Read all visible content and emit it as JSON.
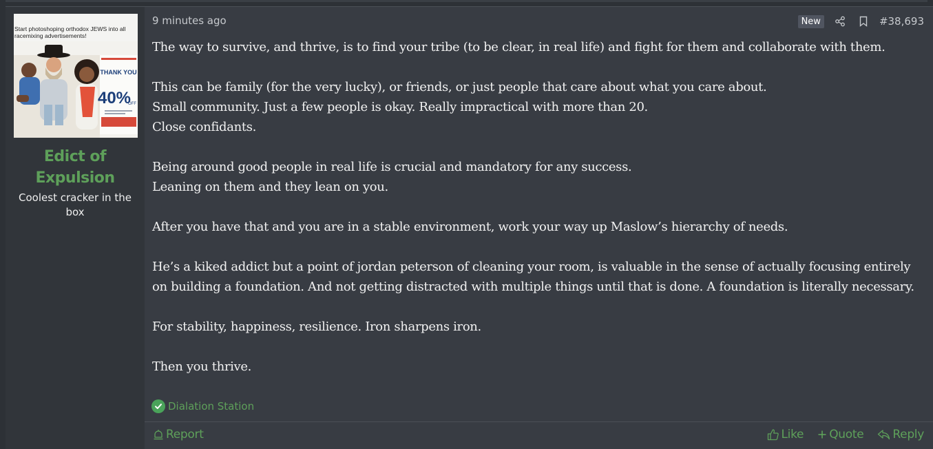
{
  "user": {
    "avatar_caption": "Start photoshoping orthodox JEWS into all racemixing advertisements!",
    "avatar_ad_line1": "THANK YOU",
    "avatar_ad_percent": "40%",
    "avatar_ad_off": "OFF",
    "name": "Edict of Expulsion",
    "title": "Coolest cracker in the box"
  },
  "meta": {
    "time": "9 minutes ago",
    "badge": "New",
    "post_number": "#38,693"
  },
  "body": {
    "paragraphs": [
      "The way to survive, and thrive, is to find your tribe (to be clear, in real life) and fight for them and collaborate with them.",
      "This can be family (for the very lucky), or friends, or just people that care about what you care about.",
      "Small community. Just a few people is okay. Really impractical with more than 20.",
      "Close confidants.",
      "Being around good people in real life is crucial and mandatory for any success.",
      "Leaning on them and they lean on you.",
      "After you have that and you are in a stable environment, work your way up Maslow’s hierarchy of needs.",
      "He’s a kiked addict but a point of jordan peterson of cleaning your room, is valuable in the sense of actually focusing entirely on building a foundation. And not getting distracted with multiple things until that is done. A foundation is literally necessary.",
      "For stability, happiness, resilience. Iron sharpens iron.",
      "Then you thrive."
    ]
  },
  "reaction": {
    "icon": "check-circle-icon",
    "label": "Dialation Station"
  },
  "footer": {
    "report": "Report",
    "like": "Like",
    "quote": "Quote",
    "reply": "Reply"
  },
  "colors": {
    "accent_green": "#5ea05a",
    "post_bg": "#383c43",
    "sidebar_bg": "#31353a",
    "text": "#f1f1f1"
  }
}
